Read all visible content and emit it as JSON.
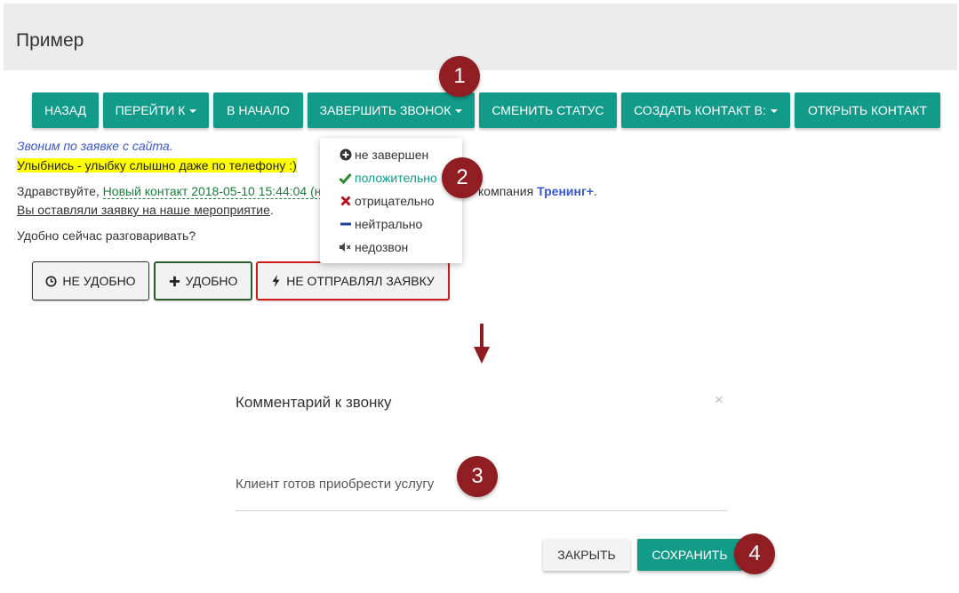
{
  "header": {
    "title": "Пример"
  },
  "toolbar": {
    "back": "Назад",
    "goto": "Перейти к",
    "start": "В начало",
    "finish_call": "Завершить звонок",
    "change_status": "Сменить статус",
    "create_contact": "Создать контакт в:",
    "open_contact": "Открыть контакт"
  },
  "dropdown": {
    "items": [
      {
        "label": "не завершен",
        "icon": "circle-plus-icon"
      },
      {
        "label": "положительно",
        "icon": "check-icon",
        "active": true
      },
      {
        "label": "отрицательно",
        "icon": "cross-icon"
      },
      {
        "label": "нейтрально",
        "icon": "minus-icon"
      },
      {
        "label": "недозвон",
        "icon": "mute-icon"
      }
    ]
  },
  "script": {
    "source_note": "Звоним по заявке с сайта.",
    "tip": "Улыбнись - улыбку слышно даже по телефону :)",
    "greeting_prefix": "Здравствуйте,",
    "contact_link": "Новый контакт 2018-05-10 15:44:04",
    "contact_suffix": "(н",
    "company_prefix": "компания",
    "company_name": "Тренинг+",
    "company_end": ".",
    "request_link": "Вы оставляли заявку на наше мероприятие",
    "request_end": ".",
    "question": "Удобно сейчас разговаривать?"
  },
  "answers": {
    "not_convenient": "Не удобно",
    "convenient": "Удобно",
    "not_sent": "Не отправлял заявку"
  },
  "modal": {
    "title": "Комментарий к звонку",
    "close_symbol": "×",
    "comment": "Клиент готов приобрести услугу",
    "close_button": "Закрыть",
    "save_button": "Сохранить"
  },
  "badges": {
    "b1": "1",
    "b2": "2",
    "b3": "3",
    "b4": "4"
  },
  "colors": {
    "accent": "#139b8a",
    "badge": "#8f1d22",
    "header_bg": "#ececec",
    "link_green": "#1d7d3c",
    "link_blue": "#3a57d6",
    "highlight": "#ffff00",
    "danger": "#cc1b1b",
    "success_border": "#2a5e2a"
  }
}
